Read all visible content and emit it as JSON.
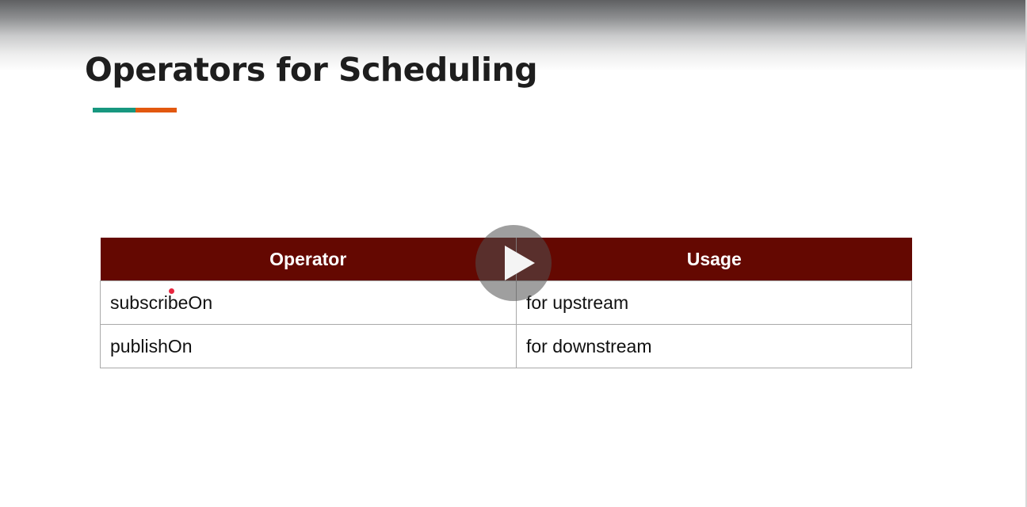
{
  "slide": {
    "title": "Operators for Scheduling",
    "accent_colors": {
      "teal": "#17977f",
      "orange": "#e2580f",
      "table_header": "#640801",
      "laser_dot": "#e8263f"
    }
  },
  "table": {
    "headers": [
      "Operator",
      "Usage"
    ],
    "rows": [
      [
        "subscribeOn",
        "for upstream"
      ],
      [
        "publishOn",
        "for downstream"
      ]
    ]
  },
  "player": {
    "play_icon": "play-icon"
  }
}
